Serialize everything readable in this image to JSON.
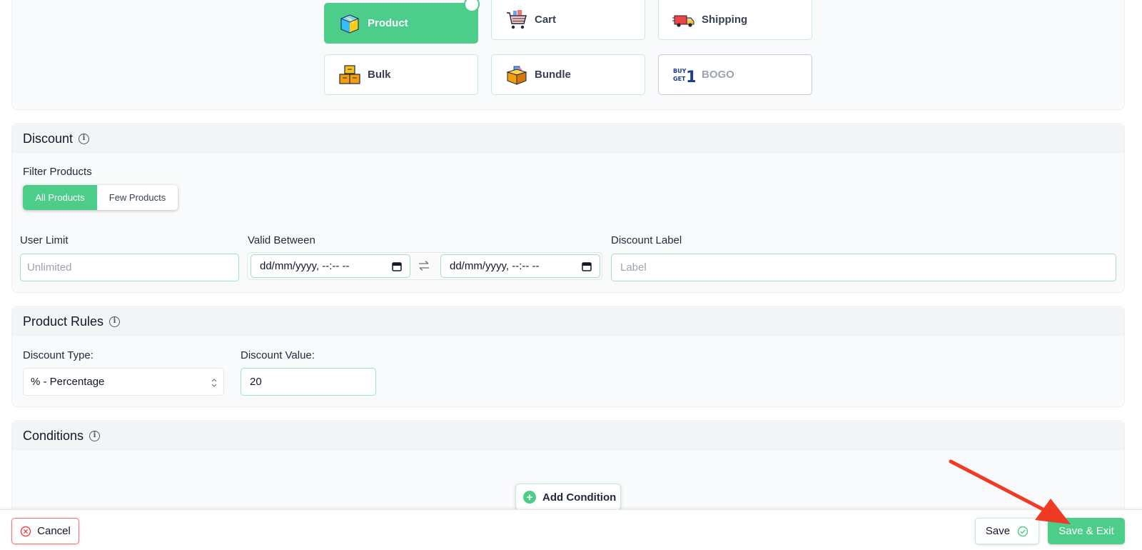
{
  "rule_types": [
    {
      "label": "Product",
      "icon": "box-icon",
      "state": "active"
    },
    {
      "label": "Cart",
      "icon": "cart-icon",
      "state": "normal"
    },
    {
      "label": "Shipping",
      "icon": "truck-icon",
      "state": "normal"
    },
    {
      "label": "Bulk",
      "icon": "boxes-icon",
      "state": "normal"
    },
    {
      "label": "Bundle",
      "icon": "bundle-icon",
      "state": "normal"
    },
    {
      "label": "BOGO",
      "icon": "buy-get-icon",
      "state": "disabled"
    }
  ],
  "discount": {
    "title": "Discount",
    "filter_label": "Filter Products",
    "filter_options": [
      "All Products",
      "Few Products"
    ],
    "filter_selected": "All Products",
    "user_limit_label": "User Limit",
    "user_limit_placeholder": "Unlimited",
    "valid_between_label": "Valid Between",
    "date_start": "dd/mm/yyyy, --:-- --",
    "date_end": "dd/mm/yyyy, --:-- --",
    "label_label": "Discount Label",
    "label_placeholder": "Label"
  },
  "product_rules": {
    "title": "Product Rules",
    "type_label": "Discount Type:",
    "type_value": "% - Percentage",
    "value_label": "Discount Value:",
    "value": "20"
  },
  "conditions": {
    "title": "Conditions",
    "add_label": "Add Condition"
  },
  "footer": {
    "cancel_label": "Cancel",
    "save_label": "Save",
    "save_exit_label": "Save & Exit"
  },
  "colors": {
    "accent": "#4ccd8a",
    "danger": "#f87171",
    "annotation_arrow": "#ef3a24"
  }
}
